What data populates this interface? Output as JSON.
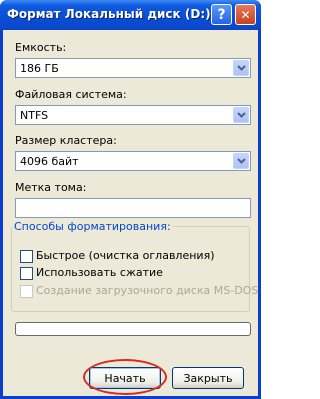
{
  "window": {
    "title": "Формат Локальный диск (D:)",
    "help_glyph": "?",
    "close_glyph": "✕"
  },
  "capacity": {
    "label": "Емкость:",
    "value": "186 ГБ"
  },
  "filesystem": {
    "label": "Файловая система:",
    "value": "NTFS"
  },
  "cluster": {
    "label": "Размер кластера:",
    "value": "4096 байт"
  },
  "volume_label": {
    "label": "Метка тома:",
    "value": ""
  },
  "format_options": {
    "title": "Способы форматирования:",
    "quick": {
      "label": "Быстрое (очистка оглавления)",
      "checked": false
    },
    "compress": {
      "label": "Использовать сжатие",
      "checked": false
    },
    "msdos": {
      "label": "Создание загрузочного диска MS-DOS",
      "checked": false,
      "enabled": false
    }
  },
  "progress": {
    "value": 0
  },
  "buttons": {
    "start": "Начать",
    "close": "Закрыть"
  },
  "colors": {
    "titlebar": "#0850d8",
    "dialog_bg": "#ece9d8",
    "group_title": "#0046d5",
    "highlight": "#d92b1e"
  },
  "icons": {
    "dropdown": "chevron-down-icon",
    "help": "help-icon",
    "close": "close-icon"
  }
}
